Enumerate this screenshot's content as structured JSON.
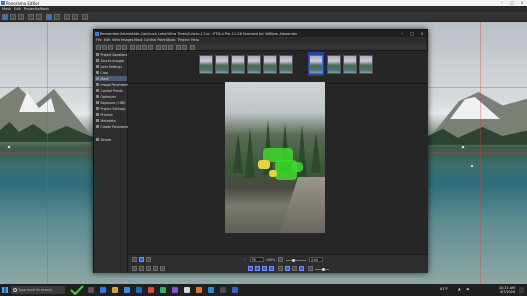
{
  "pano_editor": {
    "title": "Panorama Editor",
    "menu": [
      "Mask",
      "Edit",
      "Projection",
      "Tools"
    ]
  },
  "ptgui": {
    "title": "Remember/Intimidate-Colchuck Lake/Ultra Trees/Colchr-17-lo - PTGui Pro 11.26 licensed for William Alexander",
    "menu": [
      "File",
      "Edit",
      "View",
      "Images",
      "Mask",
      "Control Points",
      "Tools",
      "Project",
      "Help"
    ],
    "sidebar": [
      {
        "label": "Project Assistant",
        "active": false
      },
      {
        "label": "Source Images",
        "active": false
      },
      {
        "label": "Lens Settings",
        "active": false
      },
      {
        "label": "Crop",
        "active": false
      },
      {
        "label": "Mask",
        "active": true
      },
      {
        "label": "Image Parameters",
        "active": false
      },
      {
        "label": "Control Points",
        "active": false
      },
      {
        "label": "Optimizer",
        "active": false
      },
      {
        "label": "Exposure / HDR",
        "active": false
      },
      {
        "label": "Project Settings",
        "active": false
      },
      {
        "label": "Preview",
        "active": false
      },
      {
        "label": "Metadata",
        "active": false
      },
      {
        "label": "Create Panorama",
        "active": false
      },
      {
        "label": "Simple",
        "active": false
      }
    ],
    "thumbnails": 10,
    "selected_thumbnail": 6,
    "zoom_value": "Fit",
    "zoom_percent": "100%",
    "brush_size": "15",
    "brush_label": "Brush size:",
    "feather": "4 kV"
  },
  "taskbar": {
    "search_placeholder": "Type here to search",
    "time": "10:21 AM",
    "date": "4/7/2020",
    "tray_temp": "61°F"
  },
  "colors": {
    "accent": "#2f6cff",
    "mask_green": "#3cdc28",
    "mask_yellow": "#e8d23a"
  }
}
